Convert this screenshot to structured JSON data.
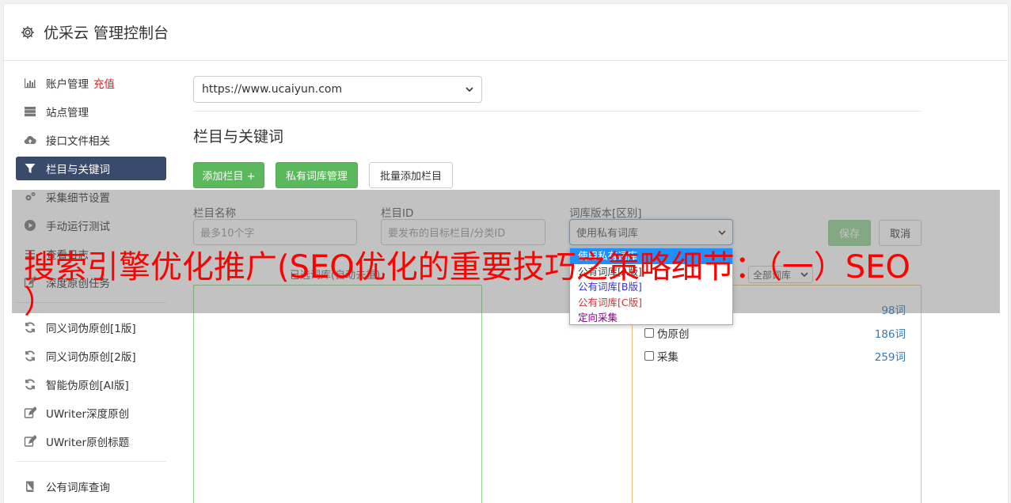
{
  "header": {
    "title": "优采云 管理控制台",
    "icon": "gear-icon"
  },
  "sidebar": {
    "items": [
      {
        "label": "账户管理",
        "icon": "bar-chart-icon",
        "extra": "充值"
      },
      {
        "label": "站点管理",
        "icon": "server-icon"
      },
      {
        "label": "接口文件相关",
        "icon": "cloud-upload-icon"
      },
      {
        "label": "栏目与关键词",
        "icon": "filter-icon",
        "active": true
      },
      {
        "label": "采集细节设置",
        "icon": "gears-icon"
      },
      {
        "label": "手动运行测试",
        "icon": "play-circle-icon"
      },
      {
        "label": "查看日志",
        "icon": "list-icon"
      },
      {
        "label": "深度原创任务",
        "icon": "edit-icon"
      },
      {
        "label": "同义词伪原创[1版]",
        "icon": "refresh-icon"
      },
      {
        "label": "同义词伪原创[2版]",
        "icon": "refresh-icon"
      },
      {
        "label": "智能伪原创[AI版]",
        "icon": "refresh-icon"
      },
      {
        "label": "UWriter深度原创",
        "icon": "edit-icon"
      },
      {
        "label": "UWriter原创标题",
        "icon": "edit-icon"
      },
      {
        "label": "公有词库查询",
        "icon": "book-icon"
      }
    ]
  },
  "main": {
    "site_select": "https://www.ucaiyun.com",
    "section_title": "栏目与关键词",
    "buttons": {
      "add_column": "添加栏目 +",
      "private_lib": "私有词库管理",
      "batch_add": "批量添加栏目",
      "save": "保存",
      "cancel": "取消"
    },
    "form": {
      "name_label": "栏目名称",
      "name_placeholder": "最多10个字",
      "id_label": "栏目ID",
      "id_placeholder": "要发布的目标栏目/分类ID",
      "version_label": "词库版本[区别]",
      "version_value": "使用私有词库"
    },
    "dropdown_options": [
      {
        "label": "使用私有词库",
        "color": "#ffffff",
        "selected": true
      },
      {
        "label": "公有词库[A版]",
        "color": "#333333"
      },
      {
        "label": "公有词库[B版]",
        "color": "#3333cc"
      },
      {
        "label": "公有词库[C版]",
        "color": "#cc3333"
      },
      {
        "label": "定向采集",
        "color": "#800080"
      }
    ],
    "selected_hint": "已选词库(自动去重)",
    "filter_select": "全部词库",
    "libraries": [
      {
        "label": "",
        "count": "98词"
      },
      {
        "label": "伪原创",
        "count": "186词"
      },
      {
        "label": "采集",
        "count": "259词"
      }
    ]
  },
  "overlay": {
    "title_line1": "搜索引擎优化推广(SEO优化的重要技巧之策略细节：（一）SEO",
    "title_line2": "）"
  }
}
